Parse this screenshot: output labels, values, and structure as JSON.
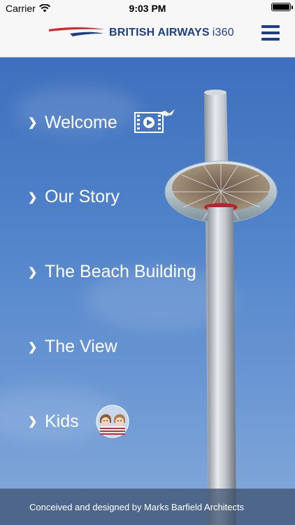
{
  "status_bar": {
    "carrier": "Carrier",
    "time": "9:03 PM",
    "icons": [
      "wifi-icon",
      "battery-icon"
    ]
  },
  "header": {
    "brand_main": "BRITISH AIRWAYS",
    "brand_sub": "i360",
    "logo_icon": "speedmarque-icon",
    "menu_icon": "hamburger-menu-icon",
    "brand_color": "#1d3f8a",
    "accent_color": "#d6262e"
  },
  "nav": {
    "items": [
      {
        "label": "Welcome",
        "icon": "video-play-icon"
      },
      {
        "label": "Our Story"
      },
      {
        "label": "The Beach Building"
      },
      {
        "label": "The View"
      },
      {
        "label": "Kids",
        "icon": "kids-avatar-icon"
      }
    ]
  },
  "footer": {
    "text": "Conceived and designed by Marks Barfield Architects"
  }
}
